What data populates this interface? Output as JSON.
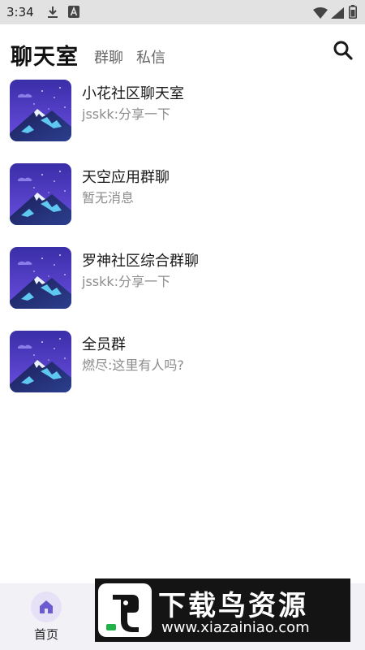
{
  "status_bar": {
    "time": "3:34",
    "icons": [
      "download-icon",
      "text-a-icon",
      "wifi-icon",
      "signal-icon",
      "battery-icon"
    ]
  },
  "header": {
    "title": "聊天室",
    "tabs": [
      {
        "label": "群聊"
      },
      {
        "label": "私信"
      }
    ],
    "search_icon": "search-icon"
  },
  "chat_list": [
    {
      "name": "小花社区聊天室",
      "preview": "jsskk:分享一下"
    },
    {
      "name": "天空应用群聊",
      "preview": "暂无消息"
    },
    {
      "name": "罗神社区综合群聊",
      "preview": "jsskk:分享一下"
    },
    {
      "name": "全员群",
      "preview": "燃尽:这里有人吗?"
    }
  ],
  "bottom_nav": {
    "items": [
      {
        "label": "首页",
        "icon": "home-icon"
      }
    ]
  },
  "watermark": {
    "title": "下载鸟资源",
    "url": "www.xiazainiao.com"
  },
  "colors": {
    "status_bar": "#e2e2e2",
    "bottom_nav": "#f2f1f6",
    "home_accent": "#6a5bd0",
    "preview_text": "#8c8c8c"
  }
}
